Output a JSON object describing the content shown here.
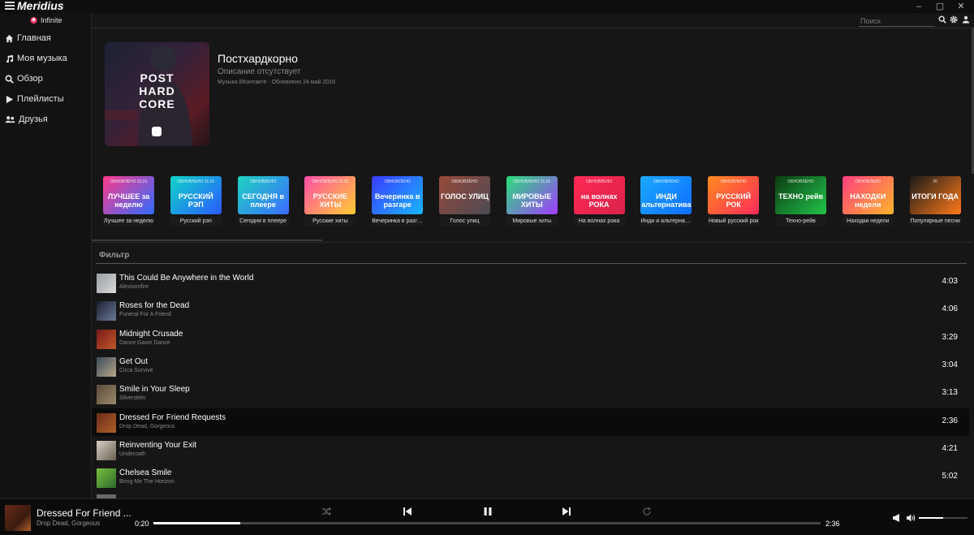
{
  "app": {
    "title": "Meridius",
    "user": "Infinite"
  },
  "window_controls": {
    "minimize": "–",
    "maximize": "▢",
    "close": "✕"
  },
  "sidebar": {
    "items": [
      {
        "label": "Главная",
        "icon": "home-icon"
      },
      {
        "label": "Моя музыка",
        "icon": "music-note-icon"
      },
      {
        "label": "Обзор",
        "icon": "search-icon"
      },
      {
        "label": "Плейлисты",
        "icon": "play-icon"
      },
      {
        "label": "Друзья",
        "icon": "users-icon"
      }
    ]
  },
  "search": {
    "placeholder": "Поиск"
  },
  "playlist": {
    "title": "Постхардкорно",
    "description": "Описание отсутствует",
    "meta": "Музыка ВКонтакте · Обновлено 24 май 2019",
    "cover_text": [
      "POST",
      "HARD",
      "CORE"
    ]
  },
  "carousel": [
    {
      "updated": "ОБНОВЛЕНО 31.01",
      "name": "ЛУЧШЕЕ за неделю",
      "caption": "Лучшее за неделю",
      "colors": [
        "#ff3b8b",
        "#2f6bff"
      ]
    },
    {
      "updated": "ОБНОВЛЕНО 31.01",
      "name": "РУССКИЙ РЭП",
      "caption": "Русский рэп",
      "colors": [
        "#0fd4c8",
        "#2a5bff"
      ]
    },
    {
      "updated": "ОБНОВЛЕНО",
      "name": "СЕГОДНЯ в плеере",
      "caption": "Сегодня в плеере",
      "colors": [
        "#1fd3c0",
        "#3a6bff"
      ]
    },
    {
      "updated": "ОБНОВЛЕНО 31.01",
      "name": "РУССКИЕ ХИТЫ",
      "caption": "Русские хиты",
      "colors": [
        "#ff4ea6",
        "#ffcc33"
      ]
    },
    {
      "updated": "ОБНОВЛЕНО",
      "name": "Вечеринка в разгаре",
      "caption": "Вечеринка в разгаре",
      "colors": [
        "#3a3bff",
        "#19b6ff"
      ]
    },
    {
      "updated": "ОБНОВЛЕНО",
      "name": "ГОЛОС УЛИЦ",
      "caption": "Голос улиц",
      "colors": [
        "#9a4a3a",
        "#4a4a56"
      ]
    },
    {
      "updated": "ОБНОВЛЕНО 31.01",
      "name": "МИРОВЫЕ ХИТЫ",
      "caption": "Мировые хиты",
      "colors": [
        "#28e07a",
        "#a23cff"
      ]
    },
    {
      "updated": "ОБНОВЛЕНО",
      "name": "на волнах РОКА",
      "caption": "На волнах рока",
      "colors": [
        "#ff2a55",
        "#d9224a"
      ]
    },
    {
      "updated": "ОБНОВЛЕНО",
      "name": "ИНДИ альтернатива",
      "caption": "Инди и альтернатива",
      "colors": [
        "#1aa9ff",
        "#0f6dff"
      ]
    },
    {
      "updated": "ОБНОВЛЕНО",
      "name": "РУССКИЙ РОК",
      "caption": "Новый русский рок",
      "colors": [
        "#ff8a1f",
        "#ff2a5a"
      ]
    },
    {
      "updated": "ОБНОВЛЕНО",
      "name": "ТЕХНО рейв",
      "caption": "Техно-рейв",
      "colors": [
        "#0b3d12",
        "#22c44a"
      ]
    },
    {
      "updated": "ОБНОВЛЕНО",
      "name": "НАХОДКИ недели",
      "caption": "Находки недели",
      "colors": [
        "#ff3e7f",
        "#ffb42a"
      ]
    },
    {
      "updated": "20",
      "name": "ИТОГИ ГОДА",
      "caption": "Популярные песни",
      "colors": [
        "#1a1a1a",
        "#ff7a1a"
      ]
    }
  ],
  "filter_label": "Фильтр",
  "tracks": [
    {
      "title": "This Could Be Anywhere in the World",
      "artist": "Alexisonfire",
      "duration": "4:03",
      "thumb": [
        "#9aa0a6",
        "#d8d8d8"
      ]
    },
    {
      "title": "Roses for the Dead",
      "artist": "Funeral For A Friend",
      "duration": "4:06",
      "thumb": [
        "#1a1f2e",
        "#6b7a99"
      ]
    },
    {
      "title": "Midnight Crusade",
      "artist": "Dance Gavin Dance",
      "duration": "3:29",
      "thumb": [
        "#7a1a1a",
        "#c0582a"
      ]
    },
    {
      "title": "Get Out",
      "artist": "Circa Survive",
      "duration": "3:04",
      "thumb": [
        "#3a4a5a",
        "#b8a88a"
      ]
    },
    {
      "title": "Smile in Your Sleep",
      "artist": "Silverstein",
      "duration": "3:13",
      "thumb": [
        "#5a4a3a",
        "#9a8a6a"
      ]
    },
    {
      "title": "Dressed For Friend Requests",
      "artist": "Drop Dead, Gorgeous",
      "duration": "2:36",
      "thumb": [
        "#6a2c18",
        "#b0602a"
      ],
      "active": true
    },
    {
      "title": "Reinventing Your Exit",
      "artist": "Underoath",
      "duration": "4:21",
      "thumb": [
        "#d8d0c4",
        "#6a6054"
      ]
    },
    {
      "title": "Chelsea Smile",
      "artist": "Bring Me The Horizon",
      "duration": "5:02",
      "thumb": [
        "#7ac040",
        "#2a6a2a"
      ]
    }
  ],
  "player": {
    "title": "Dressed For Friend ...",
    "artist": "Drop Dead, Gorgeous",
    "position": "0:20",
    "duration": "2:36",
    "progress": 0.13,
    "volume": 0.5
  }
}
